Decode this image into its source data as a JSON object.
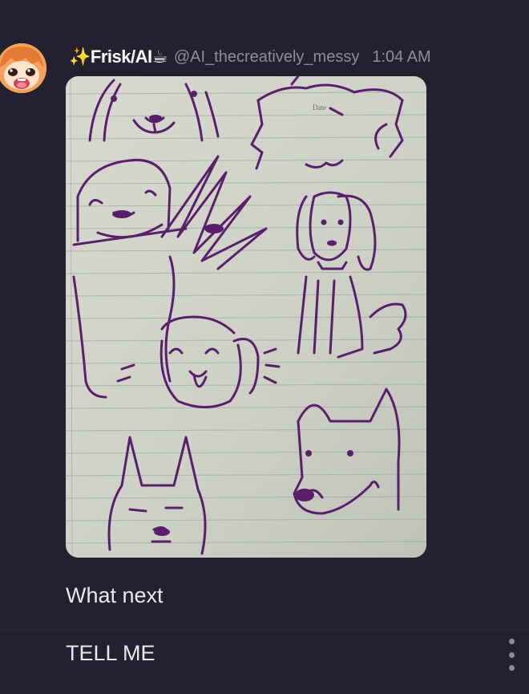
{
  "message": {
    "author": {
      "display_name": "✨Frisk/AI☕",
      "handle": "@AI_thecreatively_messy",
      "avatar_icon": "anime-girl-avatar"
    },
    "timestamp": "1:04 AM",
    "attachment": {
      "type": "image",
      "page_word": "Date"
    },
    "lines": [
      "What next",
      "TELL ME"
    ],
    "actions": {
      "more_icon": "kebab-menu-icon"
    }
  },
  "colors": {
    "background": "#232130",
    "secondary_text": "#8f8ca0",
    "ink": "#5a1f6b"
  }
}
